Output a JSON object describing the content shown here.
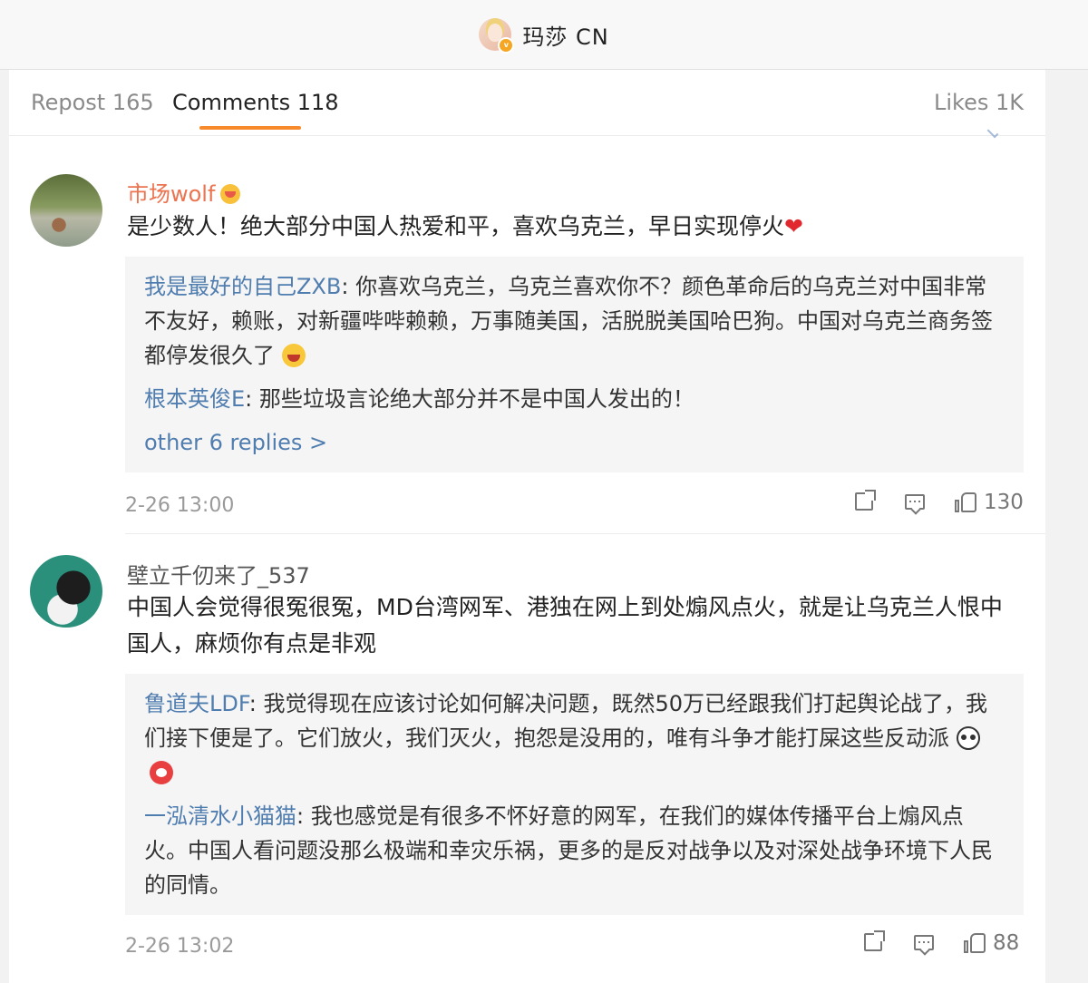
{
  "header": {
    "title": "玛莎 CN"
  },
  "tabs": [
    {
      "label": "Repost 165"
    },
    {
      "label": "Comments 118"
    },
    {
      "label": "Likes 1K"
    }
  ],
  "comments": [
    {
      "user": "市场wolf",
      "text": "是少数人！绝大部分中国人热爱和平，喜欢乌克兰，早日实现停火",
      "heart": "❤",
      "replies": [
        {
          "name": "我是最好的自己ZXB",
          "text": ": 你喜欢乌克兰，乌克兰喜欢你不？颜色革命后的乌克兰对中国非常不友好，赖账，对新疆哔哔赖赖，万事随美国，活脱脱美国哈巴狗。中国对乌克兰商务签都停发很久了"
        },
        {
          "name": "根本英俊E",
          "text": ": 那些垃圾言论绝大部分并不是中国人发出的！"
        }
      ],
      "more_label": "other 6 replies >",
      "date": "2-26 13:00",
      "likes": "130"
    },
    {
      "user": "壁立千仞来了_537",
      "text": "中国人会觉得很冤很冤，MD台湾网军、港独在网上到处煽风点火，就是让乌克兰人恨中国人，麻烦你有点是非观",
      "replies": [
        {
          "name": "鲁道夫LDF",
          "text": ": 我觉得现在应该讨论如何解决问题，既然50万已经跟我们打起舆论战了，我们接下便是了。它们放火，我们灭火，抱怨是没用的，唯有斗争才能打屎这些反动派"
        },
        {
          "name": "一泓清水小猫猫",
          "text": ": 我也感觉是有很多不怀好意的网军，在我们的媒体传播平台上煽风点火。中国人看问题没那么极端和幸灾乐祸，更多的是反对战争以及对深处战争环境下人民的同情。"
        }
      ],
      "date": "2-26 13:02",
      "likes": "88"
    }
  ]
}
